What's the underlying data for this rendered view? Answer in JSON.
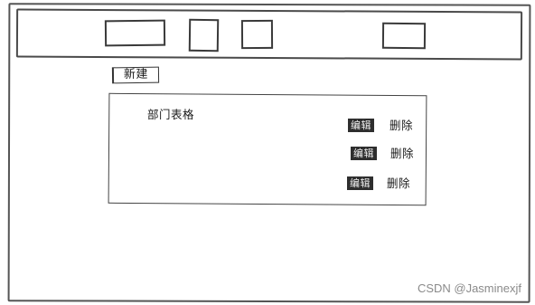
{
  "nav": {
    "boxes": [
      "",
      "",
      "",
      ""
    ]
  },
  "toolbar": {
    "new_label": "新建"
  },
  "table": {
    "title": "部门表格",
    "rows": [
      {
        "edit_label": "编辑",
        "delete_label": "删除"
      },
      {
        "edit_label": "编辑",
        "delete_label": "删除"
      },
      {
        "edit_label": "编辑",
        "delete_label": "删除"
      }
    ]
  },
  "watermark": "CSDN @Jasminexjf"
}
